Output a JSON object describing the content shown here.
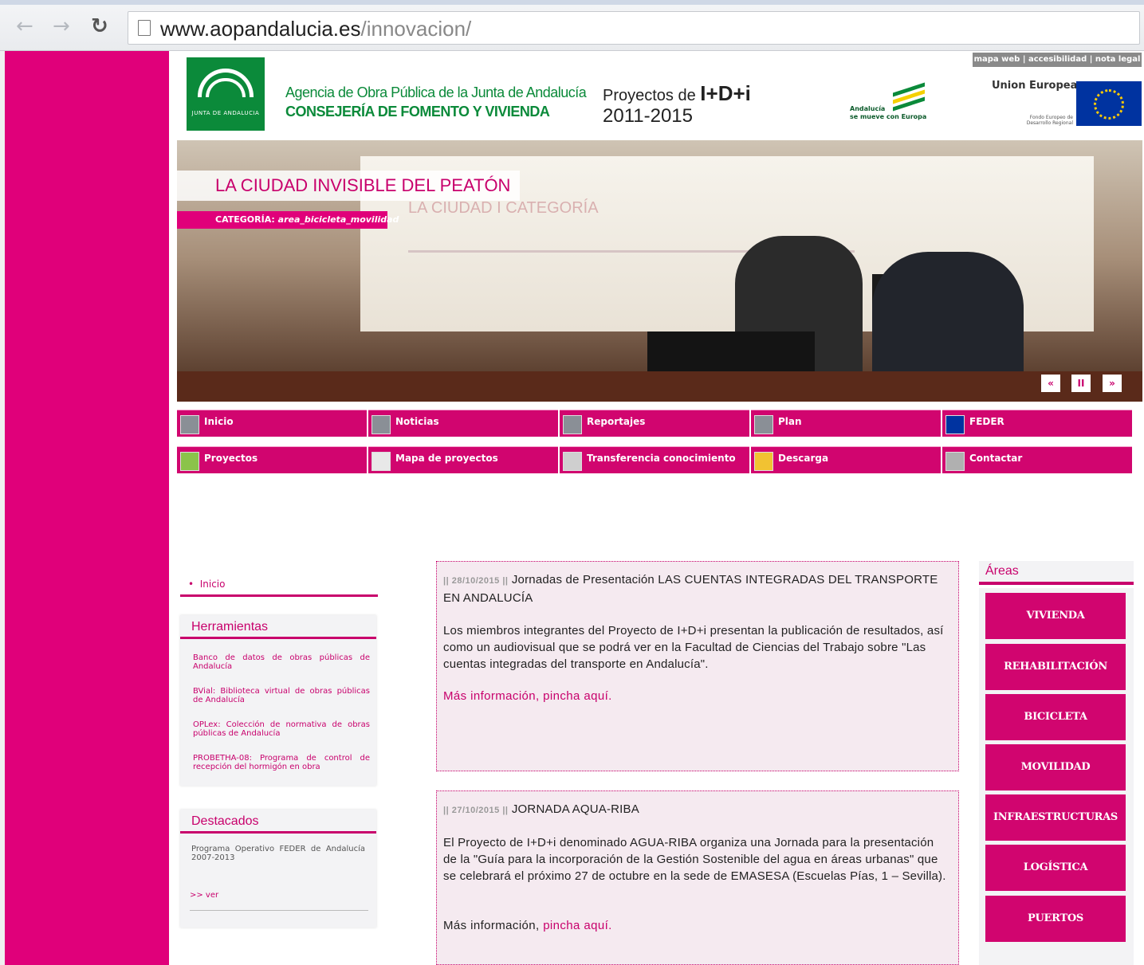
{
  "browser": {
    "back_icon": "back-arrow-icon",
    "forward_icon": "forward-arrow-icon",
    "reload_icon": "reload-icon",
    "url_host": "www.aopandalucia.es",
    "url_path": "/innovacion/"
  },
  "header": {
    "junta_logo_text": "JUNTA DE ANDALUCIA",
    "agency_line1": "Agencia de Obra Pública de la Junta de Andalucía",
    "agency_line2": "CONSEJERÍA DE FOMENTO Y VIVIENDA",
    "projects_prefix": "Proyectos de ",
    "projects_bold": "I+D+i",
    "projects_years": "2011-2015",
    "andalucia_text_1": "Andalucía",
    "andalucia_text_2": "se mueve con Europa",
    "top_links": "mapa web | accesibilidad | nota legal",
    "eu_label": "Union Europea",
    "eu_sub": "Fondo Europeo de Desarrollo Regional"
  },
  "slider": {
    "title": "LA CIUDAD INVISIBLE DEL PEATÓN",
    "category_label": "CATEGORÍA: ",
    "category_value": "area_bicicleta_movilidad",
    "screen_title": "LA CIUDAD I CATEGORÍA",
    "controls": [
      "«",
      "II",
      "»"
    ]
  },
  "nav": {
    "row1": [
      {
        "label": "Inicio",
        "icon": "home-icon"
      },
      {
        "label": "Noticias",
        "icon": "news-icon"
      },
      {
        "label": "Reportajes",
        "icon": "camera-icon"
      },
      {
        "label": "Plan",
        "icon": "plan-icon"
      },
      {
        "label": "FEDER",
        "icon": "eu-flag-icon"
      }
    ],
    "row2": [
      {
        "label": "Proyectos",
        "icon": "projects-icon"
      },
      {
        "label": "Mapa de proyectos",
        "icon": "map-icon"
      },
      {
        "label": "Transferencia conocimiento",
        "icon": "transfer-icon"
      },
      {
        "label": "Descarga",
        "icon": "download-icon"
      },
      {
        "label": "Contactar",
        "icon": "contact-icon"
      }
    ]
  },
  "sidebar": {
    "breadcrumb": "Inicio",
    "tools_title": "Herramientas",
    "tools": [
      "Banco de datos de obras públicas de Andalucía",
      "BVial: Biblioteca virtual de obras públicas de Andalucía",
      "OPLex: Colección de normativa de obras públicas de Andalucía",
      "PROBETHA-08: Programa de control de recepción del hormigón en obra"
    ],
    "featured_title": "Destacados",
    "featured_text": "Programa Operativo FEDER de Andalucía 2007-2013",
    "featured_link": ">> ver"
  },
  "news": [
    {
      "date": "|| 28/10/2015 ||",
      "title": "Jornadas de Presentación LAS CUENTAS INTEGRADAS DEL TRANSPORTE EN ANDALUCÍA",
      "body": "Los miembros integrantes del Proyecto de I+D+i presentan la publicación de resultados, así como un audiovisual que se podrá ver en la Facultad de Ciencias del Trabajo sobre \"Las cuentas integradas del transporte en Andalucía\".",
      "more_prefix": "",
      "more_link": "Más información, pincha aquí."
    },
    {
      "date": "|| 27/10/2015 ||",
      "title": "JORNADA AQUA-RIBA",
      "body": "El Proyecto de I+D+i denominado AGUA-RIBA organiza una Jornada para la presentación de la \"Guía para la incorporación de la Gestión Sostenible del agua en áreas urbanas\" que se celebrará el próximo 27 de octubre en la sede de EMASESA (Escuelas Pías, 1 – Sevilla).",
      "more_prefix": "Más información, ",
      "more_link": "pincha aquí."
    }
  ],
  "areas": {
    "title": "Áreas",
    "items": [
      "VIVIENDA",
      "REHABILITACIÓN",
      "BICICLETA",
      "MOVILIDAD",
      "INFRAESTRUCTURAS",
      "LOGÍSTICA",
      "PUERTOS"
    ]
  },
  "colors": {
    "brand_magenta": "#e0007a",
    "nav_magenta": "#d1056f",
    "junta_green": "#0b8a3a"
  }
}
